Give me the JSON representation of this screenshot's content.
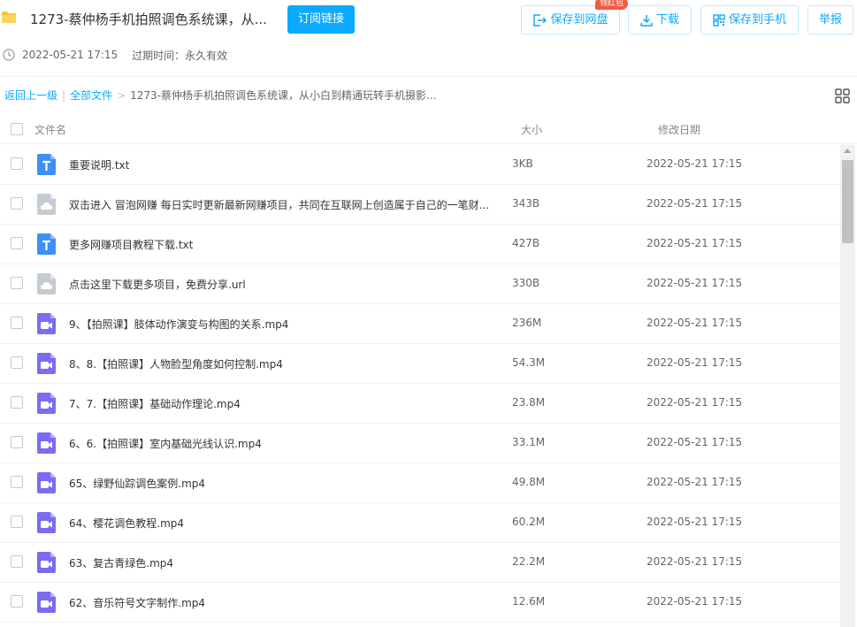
{
  "header": {
    "title": "1273-蔡仲杨手机拍照调色系统课，从...",
    "subscribe_label": "订阅链接",
    "save_netdisk_label": "保存到网盘",
    "badge_label": "领红包",
    "download_label": "下载",
    "save_phone_label": "保存到手机",
    "report_label": "举报",
    "accent_color": "#09aaff"
  },
  "meta": {
    "share_time": "2022-05-21 17:15",
    "expire_text": "过期时间：永久有效"
  },
  "breadcrumb": {
    "back": "返回上一级",
    "sep": "|",
    "all_files": "全部文件",
    "arrow": ">",
    "current": "1273-蔡仲杨手机拍照调色系统课，从小白到精通玩转手机摄影..."
  },
  "table": {
    "columns": {
      "name": "文件名",
      "size": "大小",
      "date": "修改日期"
    },
    "rows": [
      {
        "icon": "txt",
        "name": "重要说明.txt",
        "size": "3KB",
        "date": "2022-05-21 17:15"
      },
      {
        "icon": "url",
        "name": "双击进入 冒泡网赚 每日实时更新最新网赚项目，共同在互联网上创造属于自己的一笔财...",
        "size": "343B",
        "date": "2022-05-21 17:15"
      },
      {
        "icon": "txt",
        "name": "更多网赚项目教程下载.txt",
        "size": "427B",
        "date": "2022-05-21 17:15"
      },
      {
        "icon": "url",
        "name": "点击这里下载更多项目，免费分享.url",
        "size": "330B",
        "date": "2022-05-21 17:15"
      },
      {
        "icon": "video",
        "name": "9、【拍照课】肢体动作演变与构图的关系.mp4",
        "size": "236M",
        "date": "2022-05-21 17:15"
      },
      {
        "icon": "video",
        "name": "8、8.【拍照课】人物脸型角度如何控制.mp4",
        "size": "54.3M",
        "date": "2022-05-21 17:15"
      },
      {
        "icon": "video",
        "name": "7、7.【拍照课】基础动作理论.mp4",
        "size": "23.8M",
        "date": "2022-05-21 17:15"
      },
      {
        "icon": "video",
        "name": "6、6.【拍照课】室内基础光线认识.mp4",
        "size": "33.1M",
        "date": "2022-05-21 17:15"
      },
      {
        "icon": "video",
        "name": "65、绿野仙踪调色案例.mp4",
        "size": "49.8M",
        "date": "2022-05-21 17:15"
      },
      {
        "icon": "video",
        "name": "64、樱花调色教程.mp4",
        "size": "60.2M",
        "date": "2022-05-21 17:15"
      },
      {
        "icon": "video",
        "name": "63、复古青绿色.mp4",
        "size": "22.2M",
        "date": "2022-05-21 17:15"
      },
      {
        "icon": "video",
        "name": "62、音乐符号文字制作.mp4",
        "size": "12.6M",
        "date": "2022-05-21 17:15"
      }
    ]
  },
  "icons": {
    "txt": "txt-file-icon",
    "url": "link-file-icon",
    "video": "video-file-icon"
  }
}
